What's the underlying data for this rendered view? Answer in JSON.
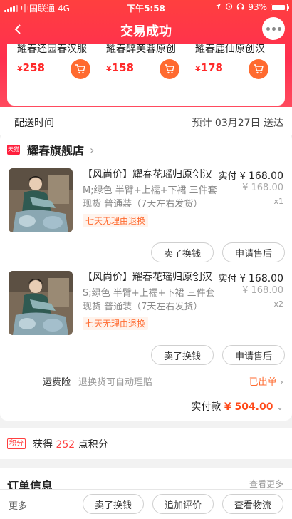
{
  "status_bar": {
    "carrier": "中国联通",
    "network": "4G",
    "time": "下午5:58",
    "battery": "93%"
  },
  "nav": {
    "title": "交易成功"
  },
  "recommendations": [
    {
      "name": "耀春还园春汉服",
      "price": "258"
    },
    {
      "name": "耀春醉芙蓉原创",
      "price": "158"
    },
    {
      "name": "耀春鹿仙原创汉",
      "price": "178"
    }
  ],
  "delivery": {
    "label": "配送时间",
    "value": "预计 03月27日 送达"
  },
  "shop": {
    "badge": "天猫",
    "name": "耀春旗舰店"
  },
  "items": [
    {
      "title": "【风尚价】耀春花瑶归原创汉",
      "spec": "M;绿色 半臂+上襦+下裙 三件套现货 普通装（7天左右发货）",
      "refund": "七天无理由退换",
      "paid_label": "实付",
      "paid_symbol": "¥",
      "paid_amount": "168.00",
      "orig": "¥ 168.00",
      "qty": "x1",
      "btn_sell": "卖了换钱",
      "btn_after": "申请售后"
    },
    {
      "title": "【风尚价】耀春花瑶归原创汉",
      "spec": "S;绿色 半臂+上襦+下裙 三件套现货 普通装（7天左右发货）",
      "refund": "七天无理由退换",
      "paid_label": "实付",
      "paid_symbol": "¥",
      "paid_amount": "168.00",
      "orig": "¥ 168.00",
      "qty": "x2",
      "btn_sell": "卖了换钱",
      "btn_after": "申请售后"
    }
  ],
  "insurance": {
    "label": "运费险",
    "desc": "退换货可自动理赔",
    "value": "已出单"
  },
  "total": {
    "label": "实付款",
    "amount": "¥ 504.00"
  },
  "points": {
    "badge": "积分",
    "prefix": "获得",
    "count": "252",
    "suffix": "点积分"
  },
  "order_info": {
    "title": "订单信息",
    "more": "查看更多"
  },
  "bottom_bar": {
    "more": "更多",
    "btn_sell": "卖了换钱",
    "btn_review": "追加评价",
    "btn_logistics": "查看物流"
  },
  "colors": {
    "brand_red": "#ff3f3f",
    "accent_orange": "#ff6a2f"
  }
}
